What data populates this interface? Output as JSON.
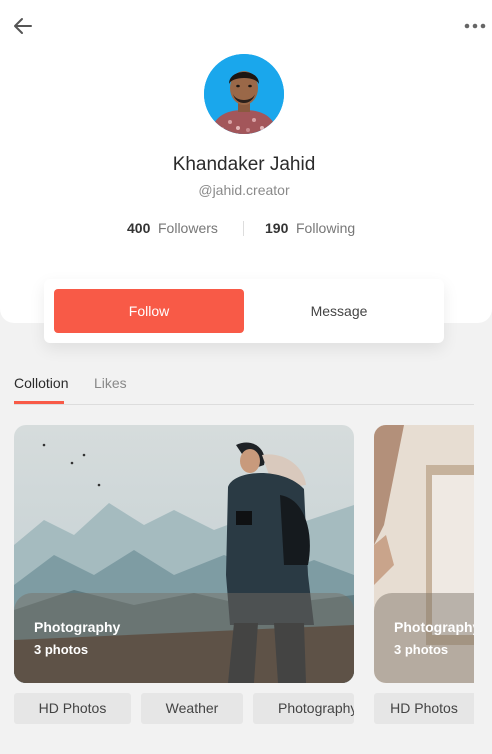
{
  "profile": {
    "name": "Khandaker Jahid",
    "handle": "@jahid.creator",
    "followers_count": "400",
    "followers_label": "Followers",
    "following_count": "190",
    "following_label": "Following"
  },
  "actions": {
    "follow_label": "Follow",
    "message_label": "Message"
  },
  "tabs": [
    {
      "label": "Collotion",
      "active": true
    },
    {
      "label": "Likes",
      "active": false
    }
  ],
  "collections": [
    {
      "title": "Photography",
      "count": "3 photos",
      "tags": [
        "HD Photos",
        "Weather",
        "Photography"
      ]
    },
    {
      "title": "Photography",
      "count": "3 photos",
      "tags": [
        "HD Photos"
      ]
    }
  ],
  "colors": {
    "accent": "#f85a47",
    "avatar_bg": "#1aa7ec",
    "background": "#f2f2f2"
  },
  "icons": [
    "arrow-left-icon",
    "more-horizontal-icon"
  ]
}
